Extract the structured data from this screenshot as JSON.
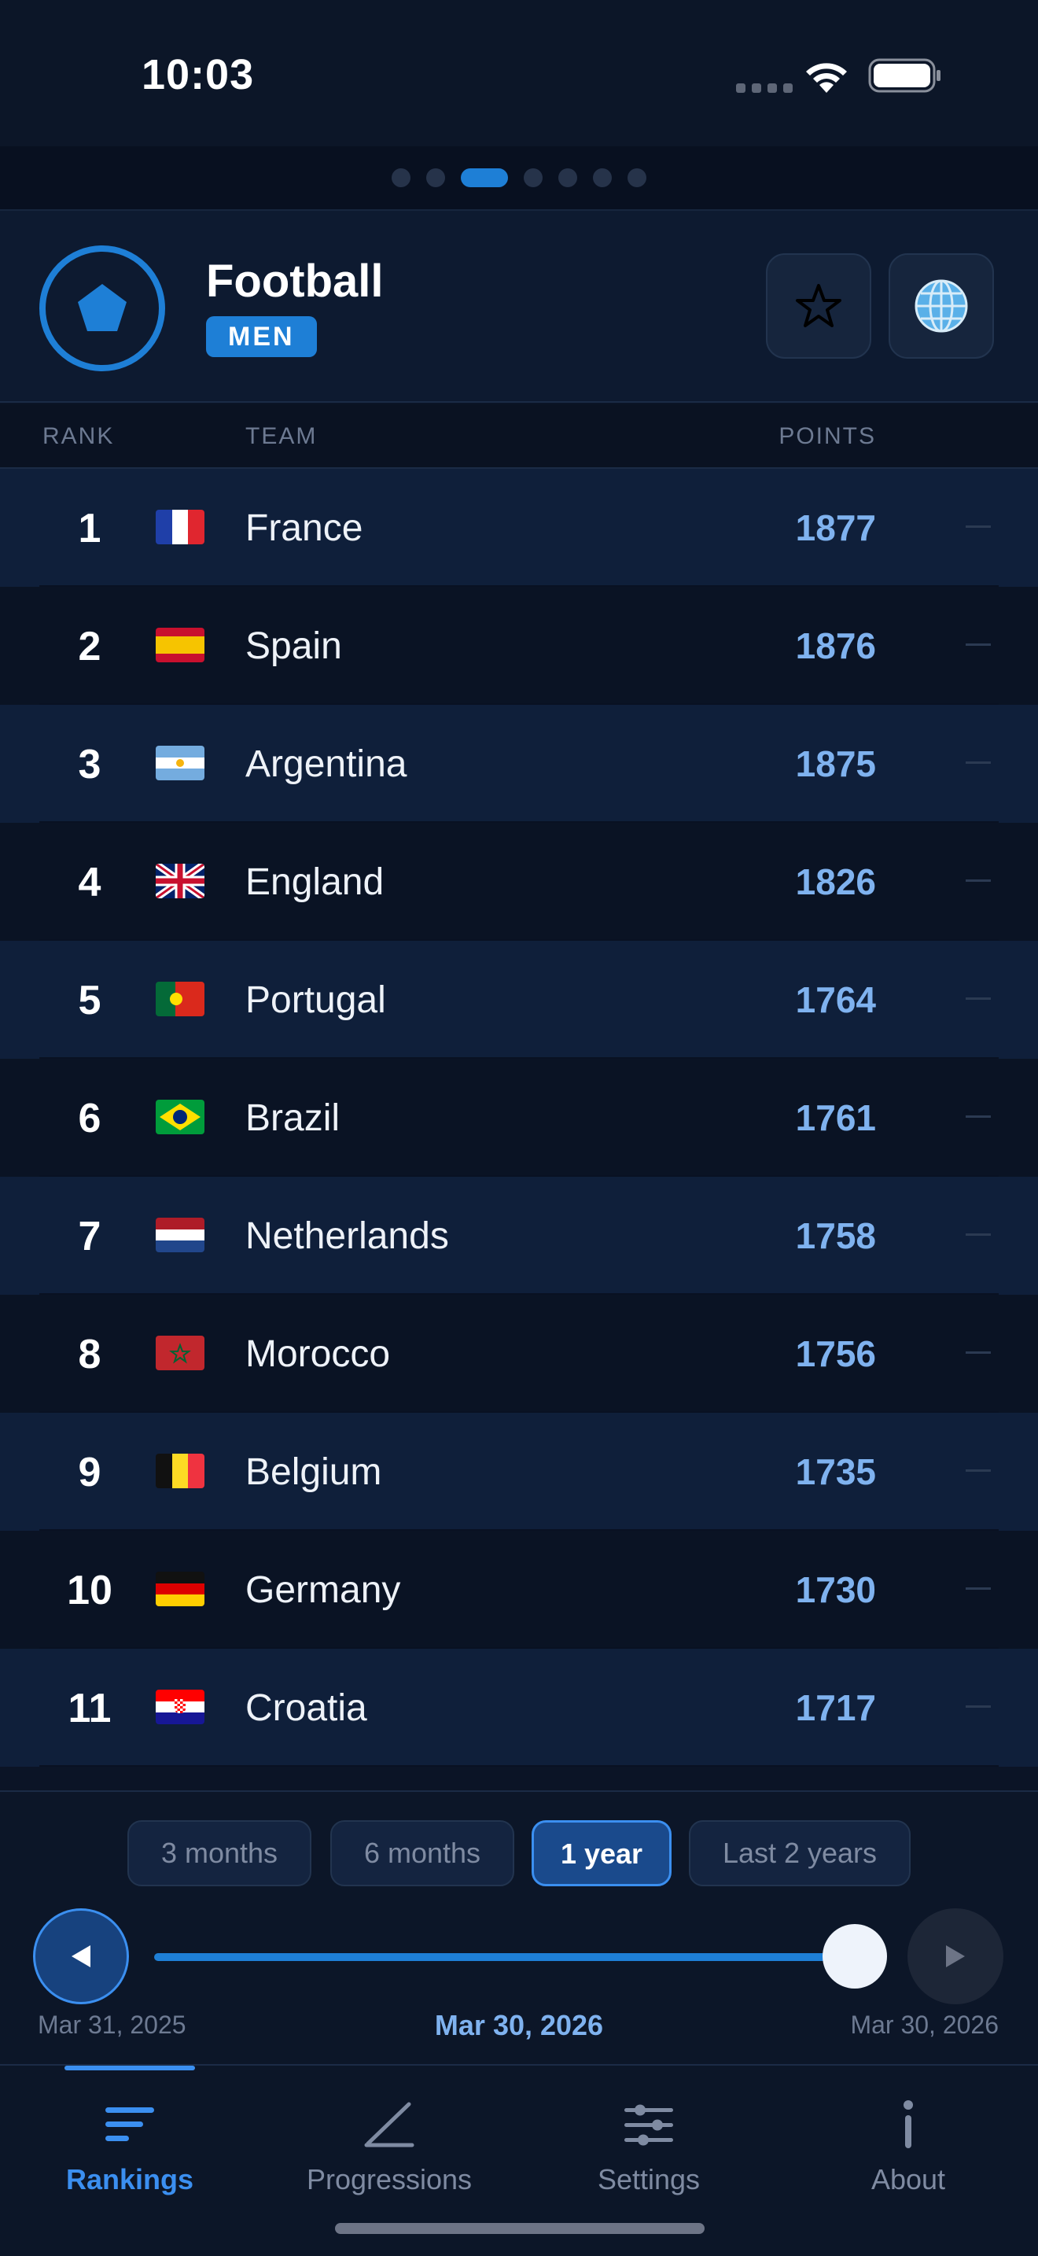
{
  "status_bar": {
    "time": "10:03"
  },
  "page_indicator": {
    "count": 7,
    "active_index": 2
  },
  "header": {
    "sport": "Football",
    "gender": "MEN",
    "favorite_icon": "star-icon",
    "region_icon": "globe-icon"
  },
  "columns": {
    "rank": "RANK",
    "team": "TEAM",
    "points": "POINTS"
  },
  "rankings": [
    {
      "rank": "1",
      "team": "France",
      "points": "1877",
      "flag": "fr",
      "trend": "—"
    },
    {
      "rank": "2",
      "team": "Spain",
      "points": "1876",
      "flag": "es",
      "trend": "—"
    },
    {
      "rank": "3",
      "team": "Argentina",
      "points": "1875",
      "flag": "ar",
      "trend": "—"
    },
    {
      "rank": "4",
      "team": "England",
      "points": "1826",
      "flag": "gb",
      "trend": "—"
    },
    {
      "rank": "5",
      "team": "Portugal",
      "points": "1764",
      "flag": "pt",
      "trend": "—"
    },
    {
      "rank": "6",
      "team": "Brazil",
      "points": "1761",
      "flag": "br",
      "trend": "—"
    },
    {
      "rank": "7",
      "team": "Netherlands",
      "points": "1758",
      "flag": "nl",
      "trend": "—"
    },
    {
      "rank": "8",
      "team": "Morocco",
      "points": "1756",
      "flag": "ma",
      "trend": "—"
    },
    {
      "rank": "9",
      "team": "Belgium",
      "points": "1735",
      "flag": "be",
      "trend": "—"
    },
    {
      "rank": "10",
      "team": "Germany",
      "points": "1730",
      "flag": "de",
      "trend": "—"
    },
    {
      "rank": "11",
      "team": "Croatia",
      "points": "1717",
      "flag": "hr",
      "trend": "—"
    }
  ],
  "time_range": {
    "options": [
      "3 months",
      "6 months",
      "1 year",
      "Last 2 years"
    ],
    "selected": "1 year",
    "start_date": "Mar 31, 2025",
    "current_date": "Mar 30, 2026",
    "end_date": "Mar 30, 2026",
    "slider_position": 1.0
  },
  "tabs": [
    {
      "label": "Rankings",
      "icon": "list-icon",
      "active": true
    },
    {
      "label": "Progressions",
      "icon": "chart-line-icon",
      "active": false
    },
    {
      "label": "Settings",
      "icon": "sliders-icon",
      "active": false
    },
    {
      "label": "About",
      "icon": "info-icon",
      "active": false
    }
  ],
  "colors": {
    "accent": "#1e7fd6",
    "points": "#7fb2ef",
    "background": "#0b1426"
  }
}
